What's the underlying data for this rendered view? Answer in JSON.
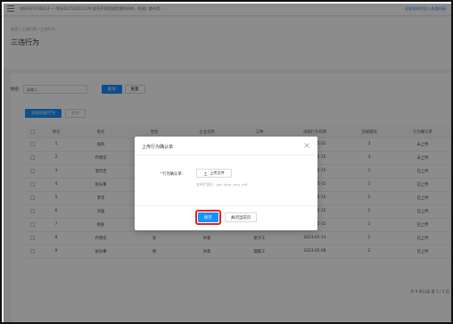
{
  "topbar": {
    "path": "AJS2021030213 — AJS20121202121AC收到不再受理受理的系统，检测）都市用…",
    "right_link": "全部材料和全入系委任板"
  },
  "breadcrumb": "首页 / 三违行为 / 三违行为",
  "page_title": "三违行为",
  "filter": {
    "label": "姓名:",
    "placeholder": "请输入",
    "search_label": "查询",
    "reset_label": "重置"
  },
  "actions": {
    "add_label": "添加违规行为",
    "delete_label": "删除"
  },
  "table": {
    "headers": [
      "",
      "序号",
      "姓名",
      "性别",
      "企业名称",
      "工种",
      "违规行为日期",
      "违规级别",
      "行为确认单"
    ],
    "rows": [
      [
        "",
        "1",
        "张四",
        "男",
        "",
        "",
        "2023-05-22",
        "3",
        "未上传"
      ],
      [
        "",
        "2",
        "乔晓华",
        "女",
        "",
        "",
        "2023-05-15",
        "3",
        "未上传"
      ],
      [
        "",
        "3",
        "温代世",
        "男",
        "",
        "",
        "2023-05-15",
        "1",
        "已上传"
      ],
      [
        "",
        "4",
        "张乐事",
        "女",
        "",
        "",
        "2023-05-15",
        "1",
        "已上传"
      ],
      [
        "",
        "5",
        "李华",
        "女",
        "",
        "",
        "2023-05-15",
        "1",
        "已上传"
      ],
      [
        "",
        "6",
        "刘强",
        "男",
        "土地",
        "普件工",
        "2023-05-15",
        "1",
        "已上传"
      ],
      [
        "",
        "7",
        "杨冬",
        "男",
        "安装",
        "混凝土工",
        "2023-05-15",
        "1",
        "已上传"
      ],
      [
        "",
        "8",
        "乔晓华",
        "女",
        "吊装",
        "架子工",
        "2023-05-13",
        "1",
        "已上传"
      ],
      [
        "",
        "9",
        "张乐事",
        "男",
        "吊装",
        "钢筋工",
        "2023-05-08",
        "2",
        "已上传"
      ]
    ]
  },
  "pagination": "共 9 条记录 第 1 / 1 页",
  "modal": {
    "title": "上传行为确认单",
    "field_required": "*",
    "field_label": "行为确认单:",
    "upload_label": "上传文件",
    "hint": "支持扩展名: .jpg .jpeg .png .pdf",
    "save_label": "保存",
    "close_label": "关闭当前页"
  },
  "colors": {
    "primary": "#1890ff",
    "danger": "#f5222d",
    "success": "#52c41a",
    "highlight": "#e02020"
  }
}
